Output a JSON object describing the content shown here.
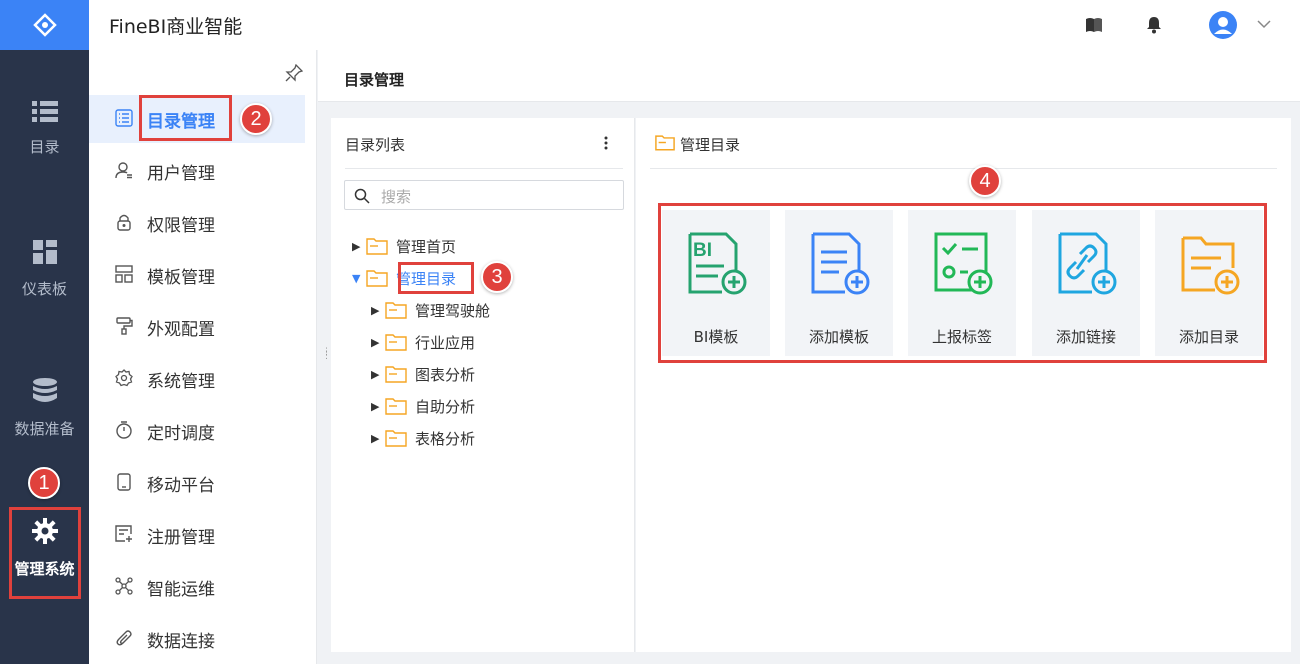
{
  "app": {
    "title": "FineBI商业智能"
  },
  "leftnav": {
    "items": [
      {
        "label": "目录",
        "icon": "list-icon"
      },
      {
        "label": "仪表板",
        "icon": "dashboard-icon"
      },
      {
        "label": "数据准备",
        "icon": "database-icon"
      },
      {
        "label": "管理系统",
        "icon": "gear-icon"
      }
    ]
  },
  "sidebar": {
    "items": [
      {
        "label": "目录管理",
        "icon": "directory-icon"
      },
      {
        "label": "用户管理",
        "icon": "user-icon"
      },
      {
        "label": "权限管理",
        "icon": "lock-icon"
      },
      {
        "label": "模板管理",
        "icon": "template-icon"
      },
      {
        "label": "外观配置",
        "icon": "paint-roller-icon"
      },
      {
        "label": "系统管理",
        "icon": "settings-icon"
      },
      {
        "label": "定时调度",
        "icon": "timer-icon"
      },
      {
        "label": "移动平台",
        "icon": "mobile-icon"
      },
      {
        "label": "注册管理",
        "icon": "register-icon"
      },
      {
        "label": "智能运维",
        "icon": "network-icon"
      },
      {
        "label": "数据连接",
        "icon": "paperclip-icon"
      }
    ]
  },
  "main": {
    "title": "目录管理"
  },
  "directory_list": {
    "title": "目录列表",
    "search_placeholder": "搜索",
    "tree": [
      {
        "label": "管理首页",
        "expanded": false
      },
      {
        "label": "管理目录",
        "expanded": true,
        "selected": true
      },
      {
        "label": "管理驾驶舱",
        "expanded": false
      },
      {
        "label": "行业应用",
        "expanded": false
      },
      {
        "label": "图表分析",
        "expanded": false
      },
      {
        "label": "自助分析",
        "expanded": false
      },
      {
        "label": "表格分析",
        "expanded": false
      }
    ]
  },
  "manage_panel": {
    "title": "管理目录",
    "cards": [
      {
        "label": "BI模板",
        "icon": "bi-template-add-icon",
        "color": "#25a36f"
      },
      {
        "label": "添加模板",
        "icon": "template-add-icon",
        "color": "#3b83f6"
      },
      {
        "label": "上报标签",
        "icon": "report-tag-add-icon",
        "color": "#22b857"
      },
      {
        "label": "添加链接",
        "icon": "link-add-icon",
        "color": "#1fa6e0"
      },
      {
        "label": "添加目录",
        "icon": "folder-add-icon",
        "color": "#f5a623"
      }
    ]
  },
  "annotations": [
    "1",
    "2",
    "3",
    "4"
  ],
  "colors": {
    "accent": "#3b83f6",
    "nav_bg": "#29344a",
    "highlight": "#e0413c",
    "folder": "#f5a623"
  }
}
